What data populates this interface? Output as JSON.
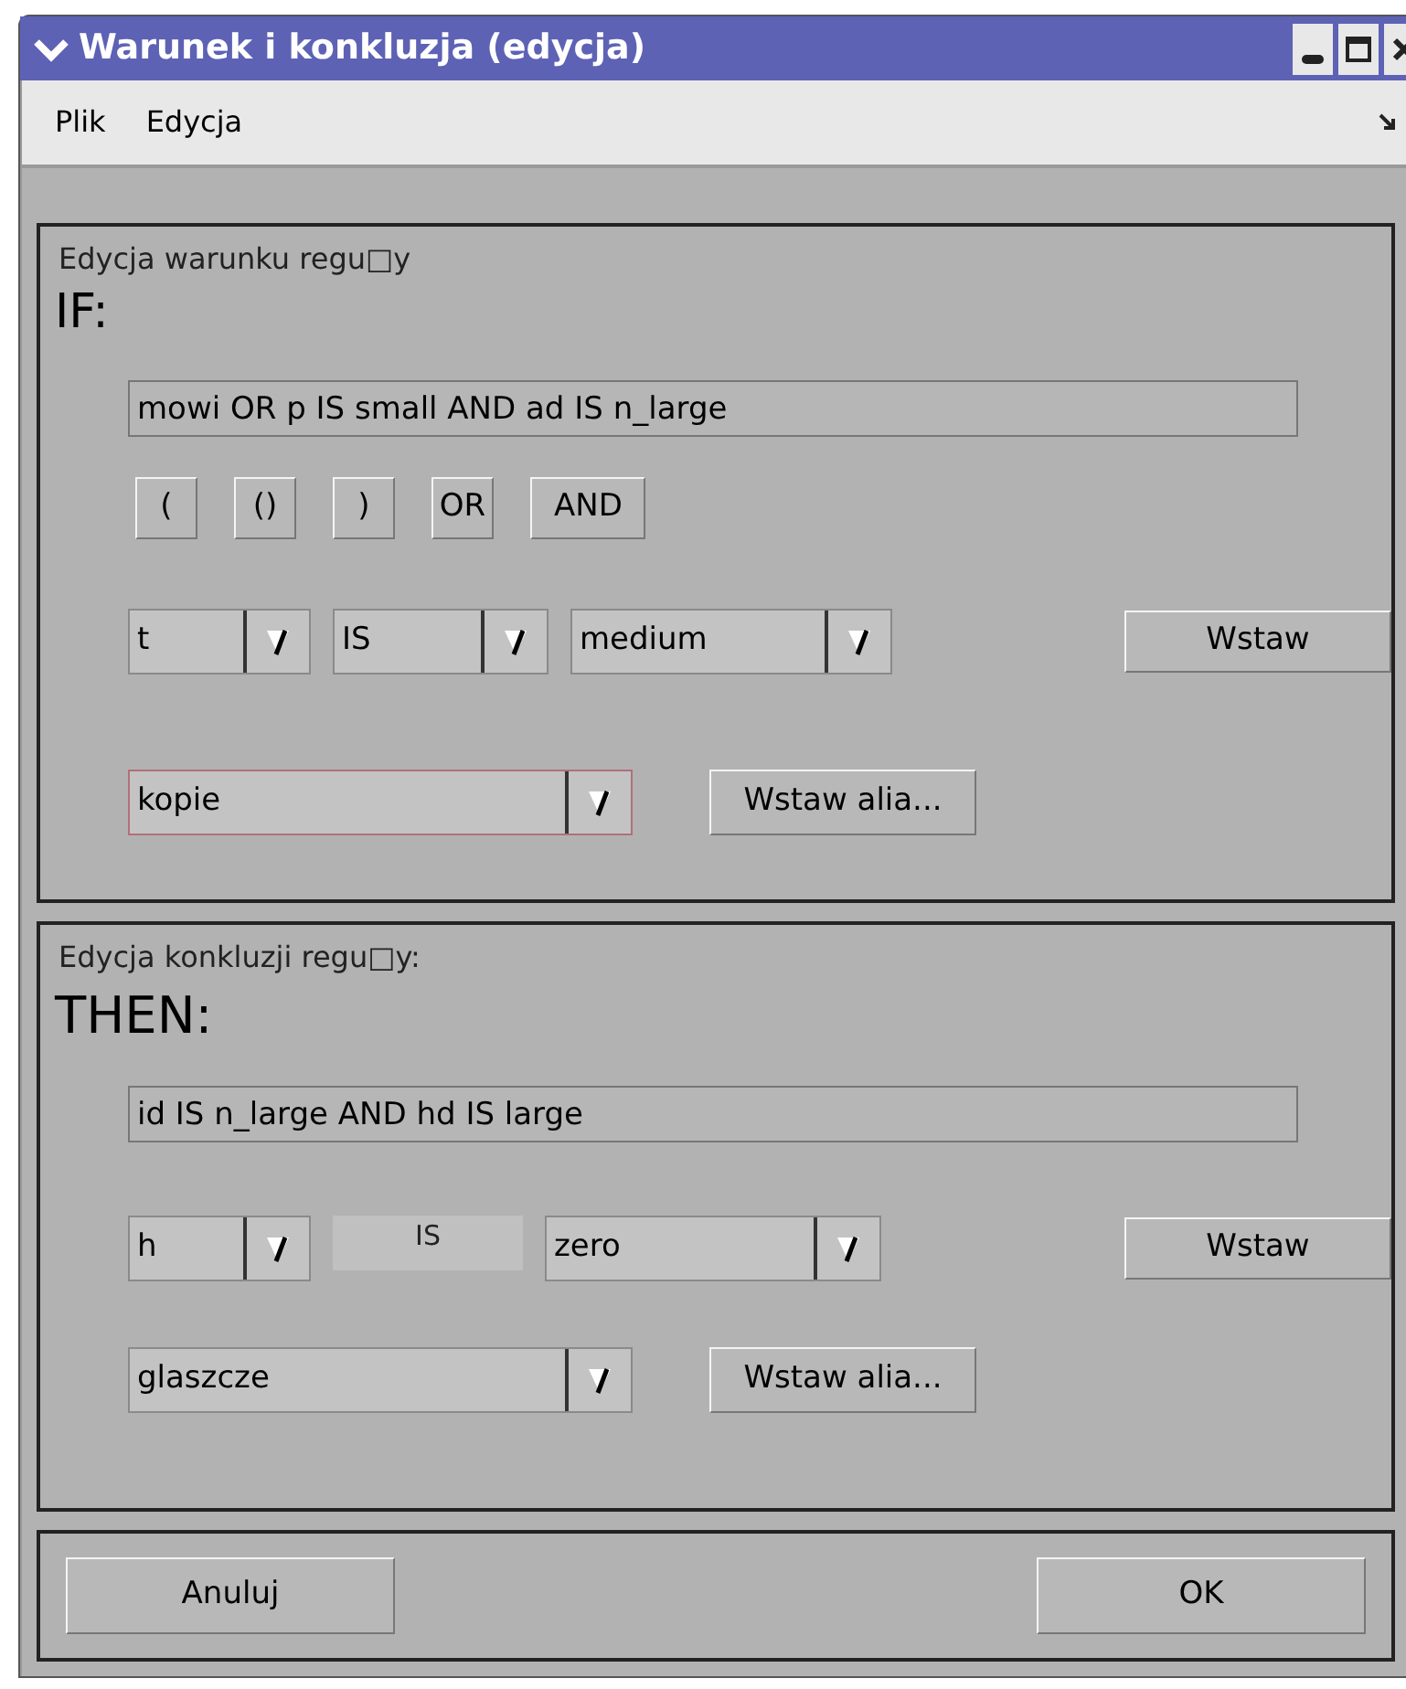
{
  "window": {
    "title": "Warunek i konkluzja (edycja)"
  },
  "menu": [
    "Plik",
    "Edycja"
  ],
  "condition": {
    "legend": "Edycja warunku regu□y",
    "keyword": "IF:",
    "expression": "mowi OR p IS small AND ad IS n_large",
    "operators": [
      "(",
      "()",
      ")",
      "OR",
      "AND"
    ],
    "row": [
      {
        "kind": "dropdown",
        "value": "t"
      },
      {
        "kind": "dropdown",
        "value": "IS"
      },
      {
        "kind": "dropdown",
        "value": "medium"
      }
    ],
    "insert": "Wstaw",
    "alias": {
      "value": "kopie",
      "focused": true
    },
    "insert_alias": "Wstaw alia..."
  },
  "conclusion": {
    "legend": "Edycja konkluzji regu□y:",
    "keyword": "THEN:",
    "expression": "id IS n_large AND hd IS large",
    "row": [
      {
        "kind": "dropdown",
        "value": "h"
      },
      {
        "kind": "label",
        "value": "IS"
      },
      {
        "kind": "dropdown",
        "value": "zero"
      }
    ],
    "insert": "Wstaw",
    "alias": {
      "value": "glaszcze",
      "focused": false
    },
    "insert_alias": "Wstaw alia..."
  },
  "buttons": [
    "Anuluj",
    "OK"
  ]
}
